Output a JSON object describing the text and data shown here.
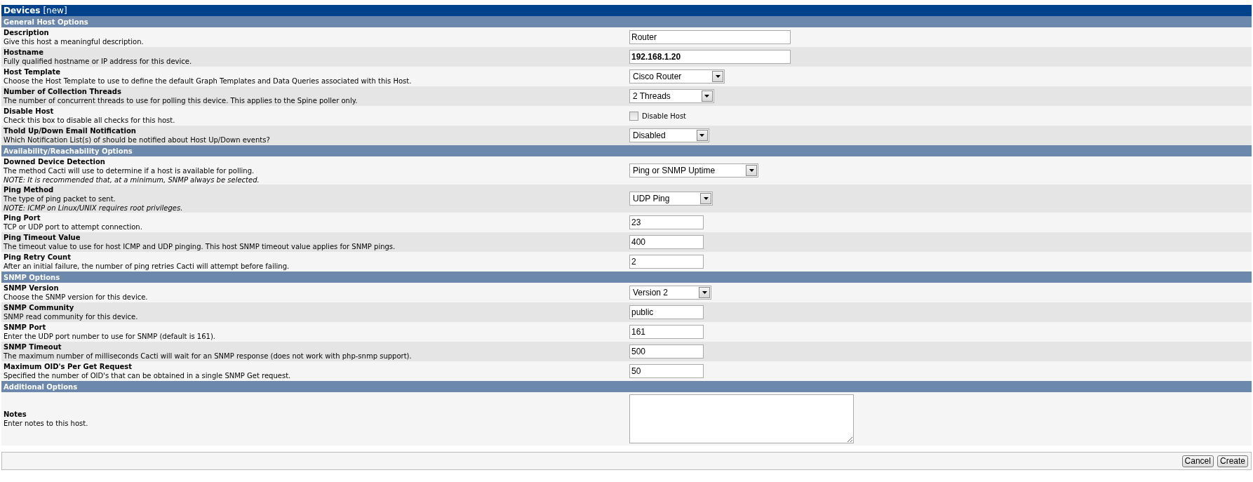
{
  "title": {
    "main": "Devices",
    "tag": "[new]"
  },
  "sections": [
    {
      "heading": "General Host Options",
      "fields": [
        {
          "label": "Description",
          "help": "Give this host a meaningful description.",
          "kind": "wide_text",
          "value": "Router"
        },
        {
          "label": "Hostname",
          "help": "Fully qualified hostname or IP address for this device.",
          "kind": "wide_text",
          "value": "192.168.1.20",
          "bold": true
        },
        {
          "label": "Host Template",
          "help": "Choose the Host Template to use to define the default Graph Templates and Data Queries associated with this Host.",
          "kind": "select",
          "value": "Cisco Router"
        },
        {
          "label": "Number of Collection Threads",
          "help": "The number of concurrent threads to use for polling this device. This applies to the Spine poller only.",
          "kind": "select",
          "value": "2 Threads"
        },
        {
          "label": "Disable Host",
          "help": "Check this box to disable all checks for this host.",
          "kind": "checkbox",
          "value": "Disable Host",
          "checked": false
        },
        {
          "label": "Thold Up/Down Email Notification",
          "help": "Which Notification List(s) of should be notified about Host Up/Down events?",
          "kind": "select",
          "value": "Disabled"
        }
      ]
    },
    {
      "heading": "Availability/Reachability Options",
      "fields": [
        {
          "label": "Downed Device Detection",
          "help": "The method Cacti will use to determine if a host is available for polling.",
          "note": "NOTE: It is recommended that, at a minimum, SNMP always be selected.",
          "kind": "select",
          "value": "Ping or SNMP Uptime"
        },
        {
          "label": "Ping Method",
          "help": "The type of ping packet to sent.",
          "note": "NOTE: ICMP on Linux/UNIX requires root privileges.",
          "kind": "select",
          "value": "UDP Ping"
        },
        {
          "label": "Ping Port",
          "help": "TCP or UDP port to attempt connection.",
          "kind": "text",
          "value": "23"
        },
        {
          "label": "Ping Timeout Value",
          "help": "The timeout value to use for host ICMP and UDP pinging. This host SNMP timeout value applies for SNMP pings.",
          "kind": "text",
          "value": "400"
        },
        {
          "label": "Ping Retry Count",
          "help": "After an initial failure, the number of ping retries Cacti will attempt before failing.",
          "kind": "text",
          "value": "2"
        }
      ]
    },
    {
      "heading": "SNMP Options",
      "fields": [
        {
          "label": "SNMP Version",
          "help": "Choose the SNMP version for this device.",
          "kind": "select",
          "value": "Version 2"
        },
        {
          "label": "SNMP Community",
          "help": "SNMP read community for this device.",
          "kind": "text",
          "value": "public"
        },
        {
          "label": "SNMP Port",
          "help": "Enter the UDP port number to use for SNMP (default is 161).",
          "kind": "text",
          "value": "161"
        },
        {
          "label": "SNMP Timeout",
          "help": "The maximum number of milliseconds Cacti will wait for an SNMP response (does not work with php-snmp support).",
          "kind": "text",
          "value": "500"
        },
        {
          "label": "Maximum OID's Per Get Request",
          "help": "Specified the number of OID's that can be obtained in a single SNMP Get request.",
          "kind": "text",
          "value": "50"
        }
      ]
    },
    {
      "heading": "Additional Options",
      "fields": [
        {
          "label": "Notes",
          "help": "Enter notes to this host.",
          "kind": "textarea"
        }
      ]
    }
  ],
  "buttons": [
    "Cancel",
    "Create"
  ]
}
